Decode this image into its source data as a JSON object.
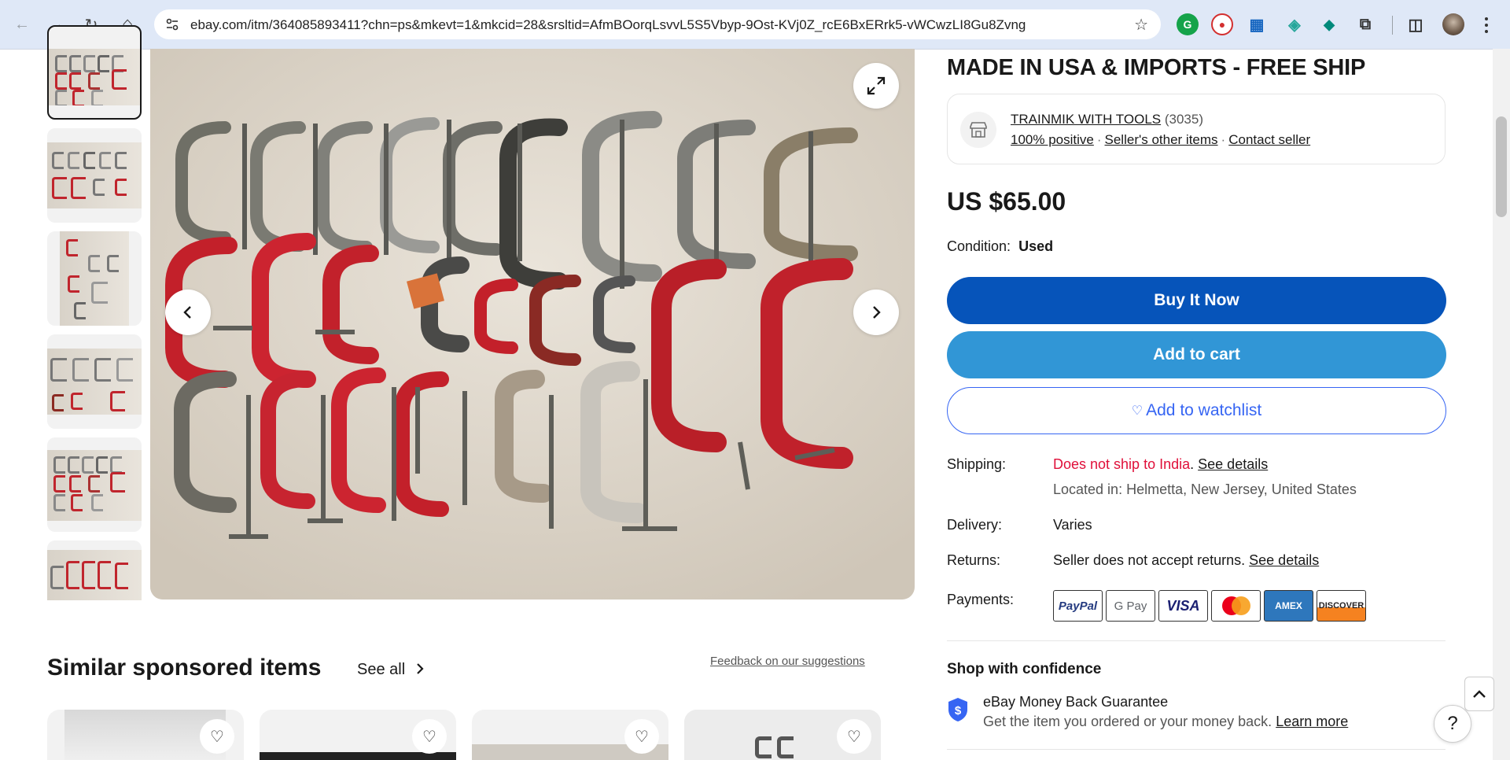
{
  "browser": {
    "url": "ebay.com/itm/364085893411?chn=ps&mkevt=1&mkcid=28&srsltid=AfmBOorqLsvvL5S5Vbyp-9Ost-KVj0Z_rcE6BxERrk5-vWCwzLI8Gu8Zvng",
    "back_icon": "←",
    "forward_icon": "→",
    "reload_icon": "↻",
    "home_icon": "⌂",
    "star_icon": "☆",
    "extensions": [
      "G",
      "●",
      "▦",
      "◈",
      "◆",
      "⧉"
    ],
    "sidepanel_icon": "◫"
  },
  "listing": {
    "title": "MADE IN USA & IMPORTS - FREE SHIP",
    "seller": {
      "name": "TRAINMIK WITH TOOLS",
      "count": "(3035)",
      "positive": "100% positive",
      "other_items": "Seller's other items",
      "contact": "Contact seller"
    },
    "price": "US $65.00",
    "condition_label": "Condition:",
    "condition_value": "Used",
    "buy_now": "Buy It Now",
    "add_to_cart": "Add to cart",
    "watchlist": "Add to watchlist",
    "shipping_label": "Shipping:",
    "shipping_status": "Does not ship to India",
    "shipping_period": ".",
    "shipping_link": "See details",
    "located": "Located in: Helmetta, New Jersey, United States",
    "delivery_label": "Delivery:",
    "delivery_value": "Varies",
    "returns_label": "Returns:",
    "returns_value": "Seller does not accept returns.",
    "returns_link": "See details",
    "payments_label": "Payments:",
    "payments": [
      "PayPal",
      "G Pay",
      "VISA",
      "Mastercard",
      "AMEX",
      "DISCOVER"
    ],
    "confidence_title": "Shop with confidence",
    "guarantee_title": "eBay Money Back Guarantee",
    "guarantee_text": "Get the item you ordered or your money back.",
    "guarantee_link": "Learn more"
  },
  "similar": {
    "title": "Similar sponsored items",
    "see_all": "See all",
    "feedback": "Feedback on our suggestions"
  },
  "colors": {
    "buy_now": "#0654ba",
    "add_to_cart": "#3196d6",
    "link_blue": "#3665f3",
    "shipping_red": "#e0103a"
  }
}
